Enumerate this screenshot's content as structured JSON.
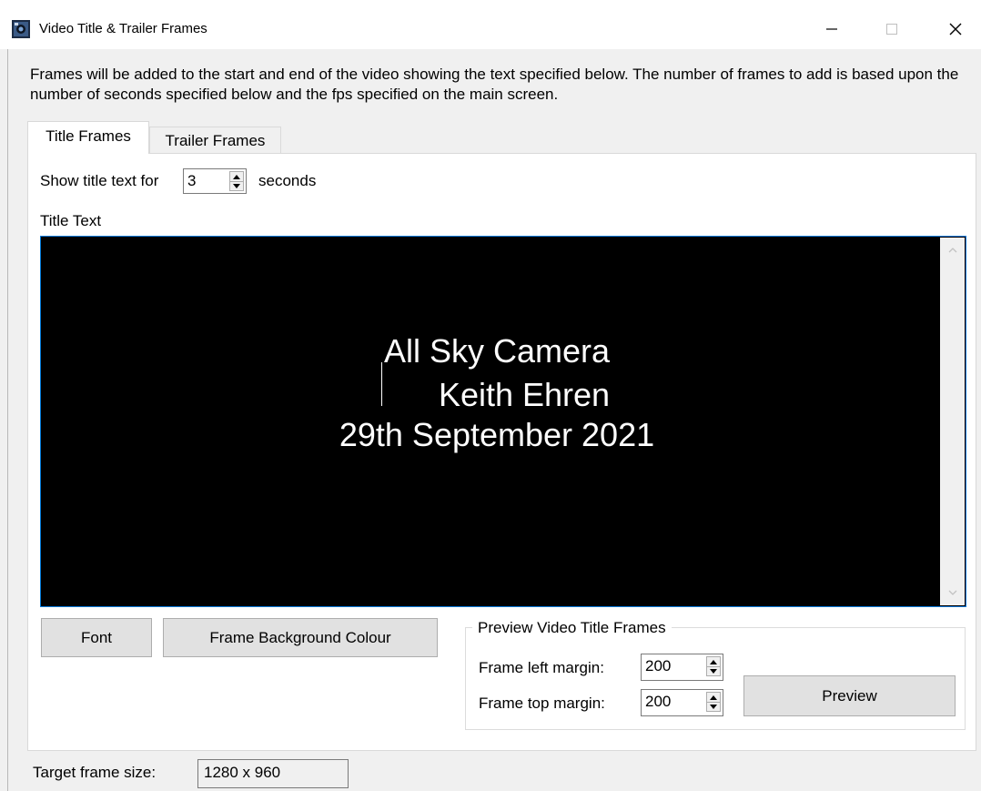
{
  "window": {
    "title": "Video Title & Trailer Frames",
    "icon": "camera-app-icon",
    "controls": [
      "minimize-icon",
      "maximize-icon",
      "close-icon"
    ]
  },
  "description": "Frames will be added to the start and end of the video showing the text specified below. The number of frames to add is based upon the number of seconds specified below and the fps specified on the main screen.",
  "tabs": [
    {
      "label": "Title Frames",
      "selected": true
    },
    {
      "label": "Trailer Frames",
      "selected": false
    }
  ],
  "title_frames": {
    "show_prefix": "Show title text for",
    "seconds_value": "3",
    "seconds_suffix": "seconds",
    "title_text_label": "Title Text",
    "title_lines": [
      "All Sky Camera",
      "Keith Ehren",
      "29th September 2021"
    ],
    "text_color": "#ffffff",
    "background_color": "#000000",
    "font_button": "Font",
    "bg_button": "Frame Background Colour",
    "preview_group": {
      "legend": "Preview Video Title Frames",
      "left_margin_label": "Frame left margin:",
      "left_margin_value": "200",
      "top_margin_label": "Frame top margin:",
      "top_margin_value": "200",
      "preview_button": "Preview"
    }
  },
  "footer": {
    "target_label": "Target frame size:",
    "target_value": "1280 x 960"
  },
  "colors": {
    "window_bg": "#f0f0f0",
    "panel_bg": "#ffffff",
    "focus_border": "#0078d7",
    "button_bg": "#e1e1e1"
  }
}
